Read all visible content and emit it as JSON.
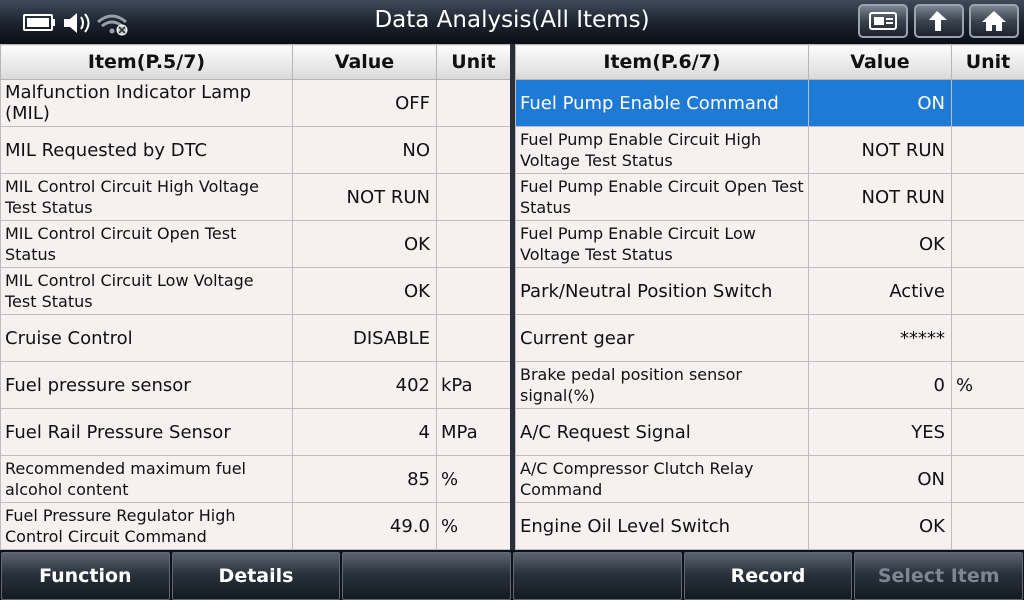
{
  "header": {
    "title": "Data Analysis(All Items)"
  },
  "left_table": {
    "columns": [
      "Item(P.5/7)",
      "Value",
      "Unit"
    ],
    "rows": [
      {
        "item": "Malfunction Indicator Lamp (MIL)",
        "value": "OFF",
        "unit": ""
      },
      {
        "item": "MIL Requested by DTC",
        "value": "NO",
        "unit": ""
      },
      {
        "item": "MIL Control Circuit High Voltage Test Status",
        "value": "NOT RUN",
        "unit": ""
      },
      {
        "item": "MIL Control Circuit Open Test Status",
        "value": "OK",
        "unit": ""
      },
      {
        "item": "MIL Control Circuit Low Voltage Test Status",
        "value": "OK",
        "unit": ""
      },
      {
        "item": "Cruise Control",
        "value": "DISABLE",
        "unit": ""
      },
      {
        "item": "Fuel pressure sensor",
        "value": "402",
        "unit": "kPa"
      },
      {
        "item": "Fuel Rail Pressure Sensor",
        "value": "4",
        "unit": "MPa"
      },
      {
        "item": "Recommended maximum fuel alcohol content",
        "value": "85",
        "unit": "%"
      },
      {
        "item": "Fuel Pressure Regulator High Control Circuit Command",
        "value": "49.0",
        "unit": "%"
      }
    ]
  },
  "right_table": {
    "columns": [
      "Item(P.6/7)",
      "Value",
      "Unit"
    ],
    "rows": [
      {
        "item": "Fuel Pump Enable Command",
        "value": "ON",
        "unit": "",
        "selected": true
      },
      {
        "item": "Fuel Pump Enable Circuit High Voltage Test Status",
        "value": "NOT RUN",
        "unit": ""
      },
      {
        "item": "Fuel Pump Enable Circuit Open Test Status",
        "value": "NOT RUN",
        "unit": ""
      },
      {
        "item": "Fuel Pump Enable Circuit Low Voltage Test Status",
        "value": "OK",
        "unit": ""
      },
      {
        "item": "Park/Neutral Position Switch",
        "value": "Active",
        "unit": ""
      },
      {
        "item": "Current gear",
        "value": "*****",
        "unit": ""
      },
      {
        "item": "Brake pedal position sensor signal(%)",
        "value": "0",
        "unit": "%"
      },
      {
        "item": "A/C Request Signal",
        "value": "YES",
        "unit": ""
      },
      {
        "item": "A/C Compressor Clutch Relay Command",
        "value": "ON",
        "unit": ""
      },
      {
        "item": "Engine Oil Level Switch",
        "value": "OK",
        "unit": ""
      }
    ]
  },
  "bottom_bar": {
    "buttons": [
      {
        "label": "Function",
        "enabled": true
      },
      {
        "label": "Details",
        "enabled": true
      },
      {
        "label": "",
        "enabled": true
      },
      {
        "label": "",
        "enabled": true
      },
      {
        "label": "Record",
        "enabled": true
      },
      {
        "label": "Select Item",
        "enabled": false
      }
    ]
  },
  "icons": {
    "status": [
      "battery-icon",
      "volume-icon",
      "wifi-off-icon"
    ],
    "toolbar": [
      "screenshot-icon",
      "back-icon",
      "home-icon"
    ]
  },
  "colors": {
    "selected_row": "#1f7ad6",
    "titlebar": "#1d2530"
  }
}
